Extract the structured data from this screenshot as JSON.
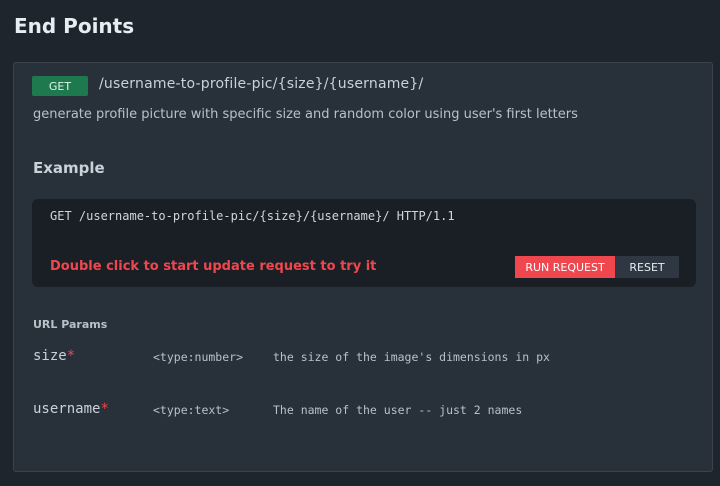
{
  "page": {
    "title": "End Points"
  },
  "endpoint": {
    "method": "GET",
    "path": "/username-to-profile-pic/{size}/{username}/",
    "description": "generate profile picture with specific size and random color using user's first letters"
  },
  "example": {
    "title": "Example",
    "request_line": "GET /username-to-profile-pic/{size}/{username}/ HTTP/1.1",
    "hint": "Double click to start update request to try it",
    "run_label": "RUN REQUEST",
    "reset_label": "RESET"
  },
  "params": {
    "title": "URL Params",
    "required_marker": "*",
    "items": [
      {
        "name": "size",
        "type": "<type:number>",
        "description": "the size of the image's dimensions in px"
      },
      {
        "name": "username",
        "type": "<type:text>",
        "description": "The name of the user -- just 2 names"
      }
    ]
  },
  "colors": {
    "background": "#1f252d",
    "card": "#283039",
    "method_get": "#1e7a4e",
    "accent_red": "#f0474e"
  }
}
